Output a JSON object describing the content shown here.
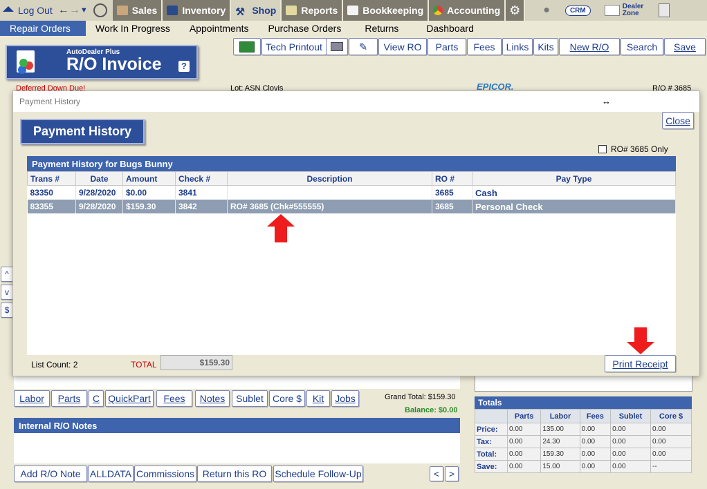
{
  "topnav": {
    "logout": "Log Out",
    "tabs": [
      "Sales",
      "Inventory",
      "Shop",
      "Reports",
      "Bookkeeping",
      "Accounting"
    ],
    "crm": "CRM",
    "dealer_zone_1": "Dealer",
    "dealer_zone_2": "Zone"
  },
  "subnav": [
    "Repair Orders",
    "Work In Progress",
    "Appointments",
    "Purchase Orders",
    "Returns",
    "Dashboard"
  ],
  "toolbar": {
    "tech_printout": "Tech Printout",
    "view_ro": "View RO",
    "parts": "Parts",
    "fees": "Fees",
    "links": "Links",
    "kits": "Kits",
    "new_ro": "New R/O",
    "search": "Search",
    "save": "Save"
  },
  "logo": {
    "small": "AutoDealer Plus",
    "big": "R/O Invoice",
    "help": "?"
  },
  "header": {
    "deferred": "Deferred Down Due!",
    "lot": "Lot: ASN Clovis",
    "brand": "EPICOR.",
    "ro_number": "R/O # 3685"
  },
  "side_buttons": [
    "^",
    "v",
    "$"
  ],
  "modal": {
    "window_title": "Payment History",
    "heading": "Payment History",
    "close": "Close",
    "ro_only_label": "RO# 3685 Only",
    "panel_title": "Payment History for Bugs Bunny",
    "columns": [
      "Trans #",
      "Date",
      "Amount",
      "Check #",
      "Description",
      "RO #",
      "Pay Type"
    ],
    "rows": [
      [
        "83350",
        "9/28/2020",
        "$0.00",
        "3841",
        "",
        "3685",
        "Cash"
      ],
      [
        "83355",
        "9/28/2020",
        "$159.30",
        "3842",
        "RO# 3685 (Chk#555555)",
        "3685",
        "Personal Check"
      ]
    ],
    "list_count": "List Count: 2",
    "total_label": "TOTAL",
    "total_value": "$159.30",
    "print_receipt": "Print Receipt"
  },
  "bottom_tabs": [
    "Labor",
    "Parts",
    "C",
    "QuickPart",
    "Fees",
    "Notes",
    "Sublet",
    "Core $",
    "Kit",
    "Jobs"
  ],
  "grand_total": "Grand Total:  $159.30",
  "balance": "Balance: $0.00",
  "internal_notes": "Internal R/O Notes",
  "bottom_buttons": [
    "Add R/O Note",
    "ALLDATA",
    "Commissions",
    "Return this RO",
    "Schedule Follow-Up"
  ],
  "pager": [
    "<",
    ">"
  ],
  "totals": {
    "title": "Totals",
    "columns": [
      "",
      "Parts",
      "Labor",
      "Fees",
      "Sublet",
      "Core $"
    ],
    "rows": [
      [
        "Price:",
        "0.00",
        "135.00",
        "0.00",
        "0.00",
        "0.00"
      ],
      [
        "Tax:",
        "0.00",
        "24.30",
        "0.00",
        "0.00",
        "0.00"
      ],
      [
        "Total:",
        "0.00",
        "159.30",
        "0.00",
        "0.00",
        "0.00"
      ],
      [
        "Save:",
        "0.00",
        "15.00",
        "0.00",
        "0.00",
        "--"
      ]
    ]
  }
}
